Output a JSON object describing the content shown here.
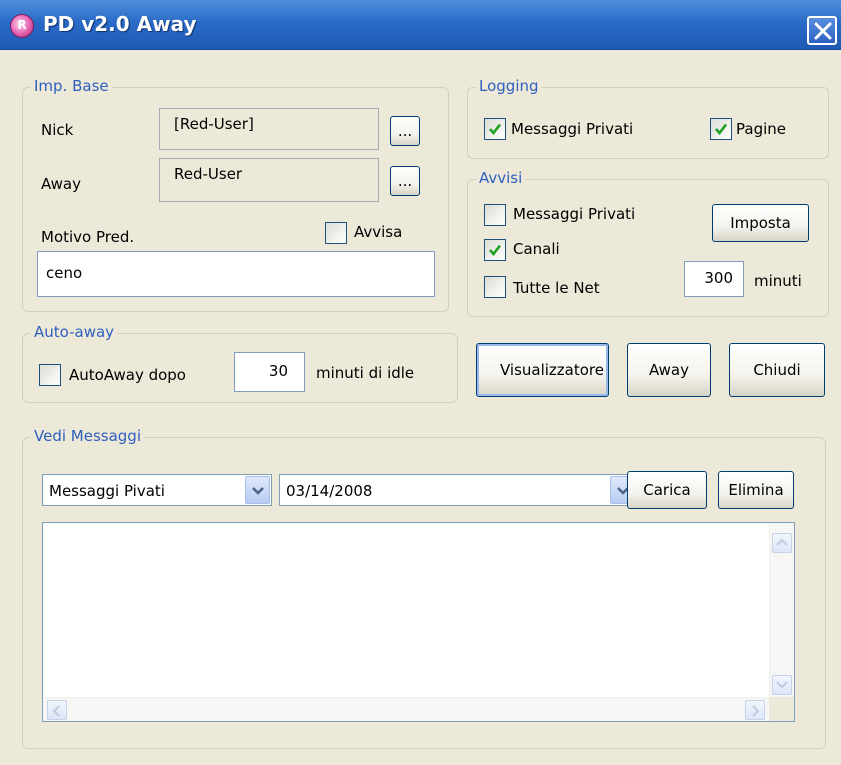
{
  "window": {
    "title": "PD v2.0 Away"
  },
  "imp_base": {
    "legend": "Imp. Base",
    "nick_label": "Nick",
    "nick_value": "[Red-User]",
    "nick_browse": "...",
    "away_label": "Away",
    "away_value": "Red-User",
    "away_browse": "...",
    "motivo_label": "Motivo Pred.",
    "avvisa_label": "Avvisa",
    "avvisa_checked": false,
    "motivo_value": "ceno"
  },
  "logging": {
    "legend": "Logging",
    "messaggi_privati_label": "Messaggi Privati",
    "messaggi_privati_checked": true,
    "pagine_label": "Pagine",
    "pagine_checked": true
  },
  "avvisi": {
    "legend": "Avvisi",
    "messaggi_privati_label": "Messaggi Privati",
    "messaggi_privati_checked": false,
    "canali_label": "Canali",
    "canali_checked": true,
    "tutte_net_label": "Tutte le Net",
    "tutte_net_checked": false,
    "imposta_button": "Imposta",
    "minuti_value": "300",
    "minuti_label": "minuti"
  },
  "auto_away": {
    "legend": "Auto-away",
    "autoaway_label": "AutoAway dopo",
    "autoaway_checked": false,
    "minutes_value": "30",
    "idle_label": "minuti di idle"
  },
  "actions": {
    "visualizzatore_button": "Visualizzatore",
    "away_button": "Away",
    "chiudi_button": "Chiudi"
  },
  "vedi_messaggi": {
    "legend": "Vedi Messaggi",
    "type_selected": "Messaggi Pivati",
    "date_selected": "03/14/2008",
    "carica_button": "Carica",
    "elimina_button": "Elimina",
    "content": ""
  },
  "icons": {
    "close": "close-icon",
    "app": "app-icon",
    "check": "check-icon",
    "dropdown": "chevron-down-icon"
  },
  "colors": {
    "titlebar": "#2a6bc8",
    "legend_text": "#2f5fc0",
    "window_bg": "#ece9d8",
    "check_mark": "#21a121"
  }
}
